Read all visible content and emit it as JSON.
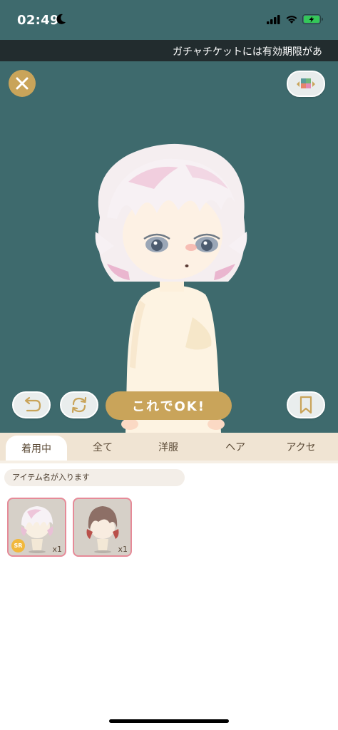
{
  "status_bar": {
    "time": "02:49",
    "battery_color": "#34c759"
  },
  "ticker": {
    "text": "ガチャチケットには有効期限があ"
  },
  "stage": {
    "background": "#3e6a6d",
    "ok_label": "これでOK!",
    "accent": "#c9a45a"
  },
  "tabs": [
    {
      "label": "着用中",
      "active": true
    },
    {
      "label": "全て"
    },
    {
      "label": "洋服"
    },
    {
      "label": "ヘア"
    },
    {
      "label": "アクセ"
    }
  ],
  "search": {
    "placeholder": "アイテム名が入ります"
  },
  "items": [
    {
      "qty": "x1",
      "badge": "SR",
      "icon": "white-pink-hair-item"
    },
    {
      "qty": "x1",
      "icon": "brown-red-hair-item"
    }
  ],
  "icons": {
    "close": "close-icon",
    "background": "palette-icon",
    "undo": "undo-icon",
    "rotate": "rotate-icon",
    "bookmark": "bookmark-icon"
  }
}
